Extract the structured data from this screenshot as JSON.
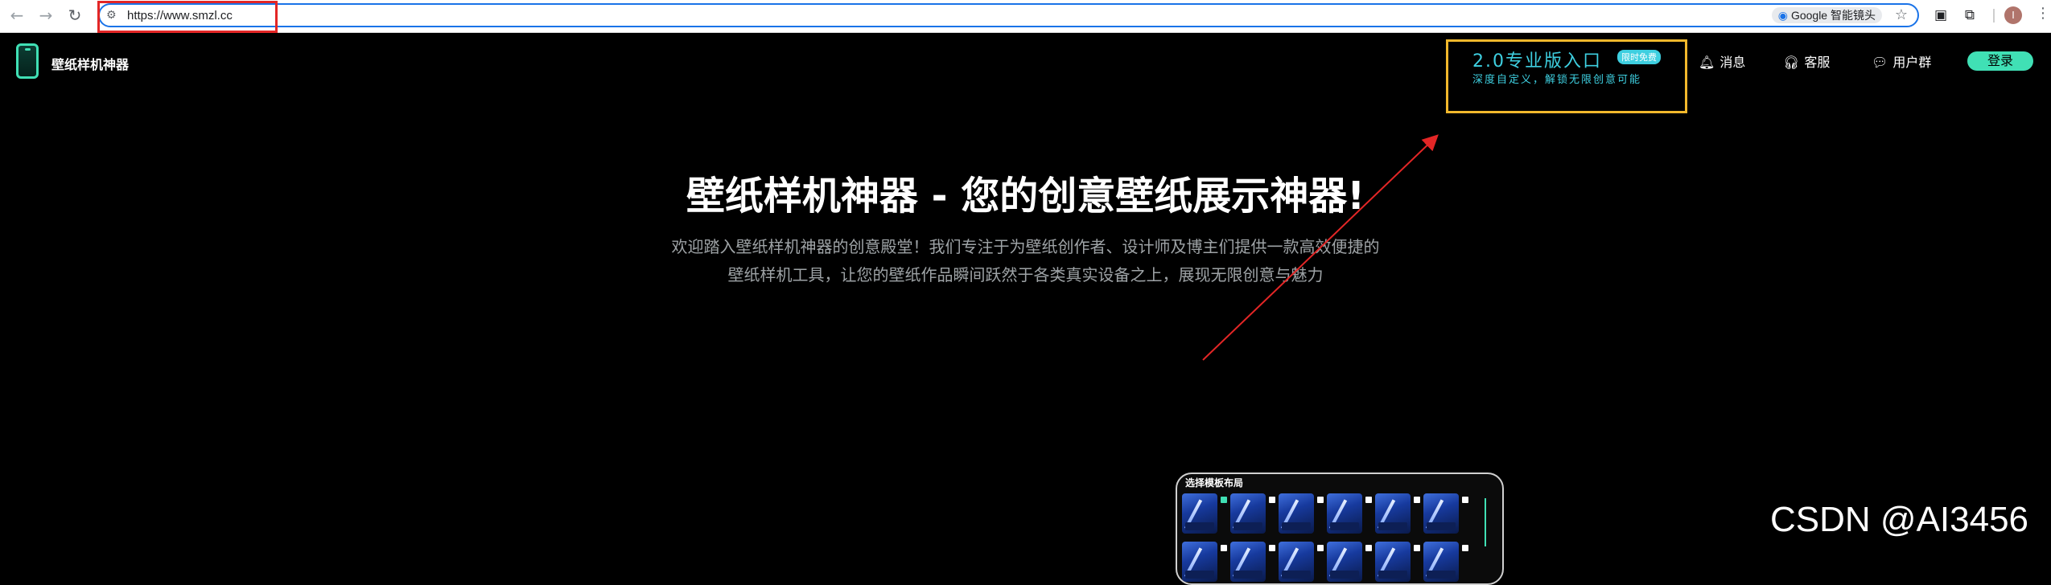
{
  "browser": {
    "url": "https://www.smzl.cc",
    "lens_label": "Google 智能镜头",
    "profile_initial": "I"
  },
  "header": {
    "brand": "壁纸样机神器",
    "promo": {
      "title": "2.0专业版入口",
      "badge": "限时免费",
      "subtitle": "深度自定义，解锁无限创意可能"
    },
    "nav": {
      "messages": "消息",
      "service": "客服",
      "group": "用户群",
      "login": "登录"
    }
  },
  "hero": {
    "title": "壁纸样机神器 - 您的创意壁纸展示神器!",
    "desc_line1": "欢迎踏入壁纸样机神器的创意殿堂！我们专注于为壁纸创作者、设计师及博主们提供一款高效便捷的",
    "desc_line2": "壁纸样机工具，让您的壁纸作品瞬间跃然于各类真实设备之上，展现无限创意与魅力"
  },
  "panel": {
    "title": "选择模板布局"
  },
  "watermark": "CSDN @AI3456",
  "colors": {
    "accent": "#40e0b5",
    "promo_border": "#f1b82c",
    "promo_text": "#3ecfe0",
    "annotation": "#e32626"
  }
}
